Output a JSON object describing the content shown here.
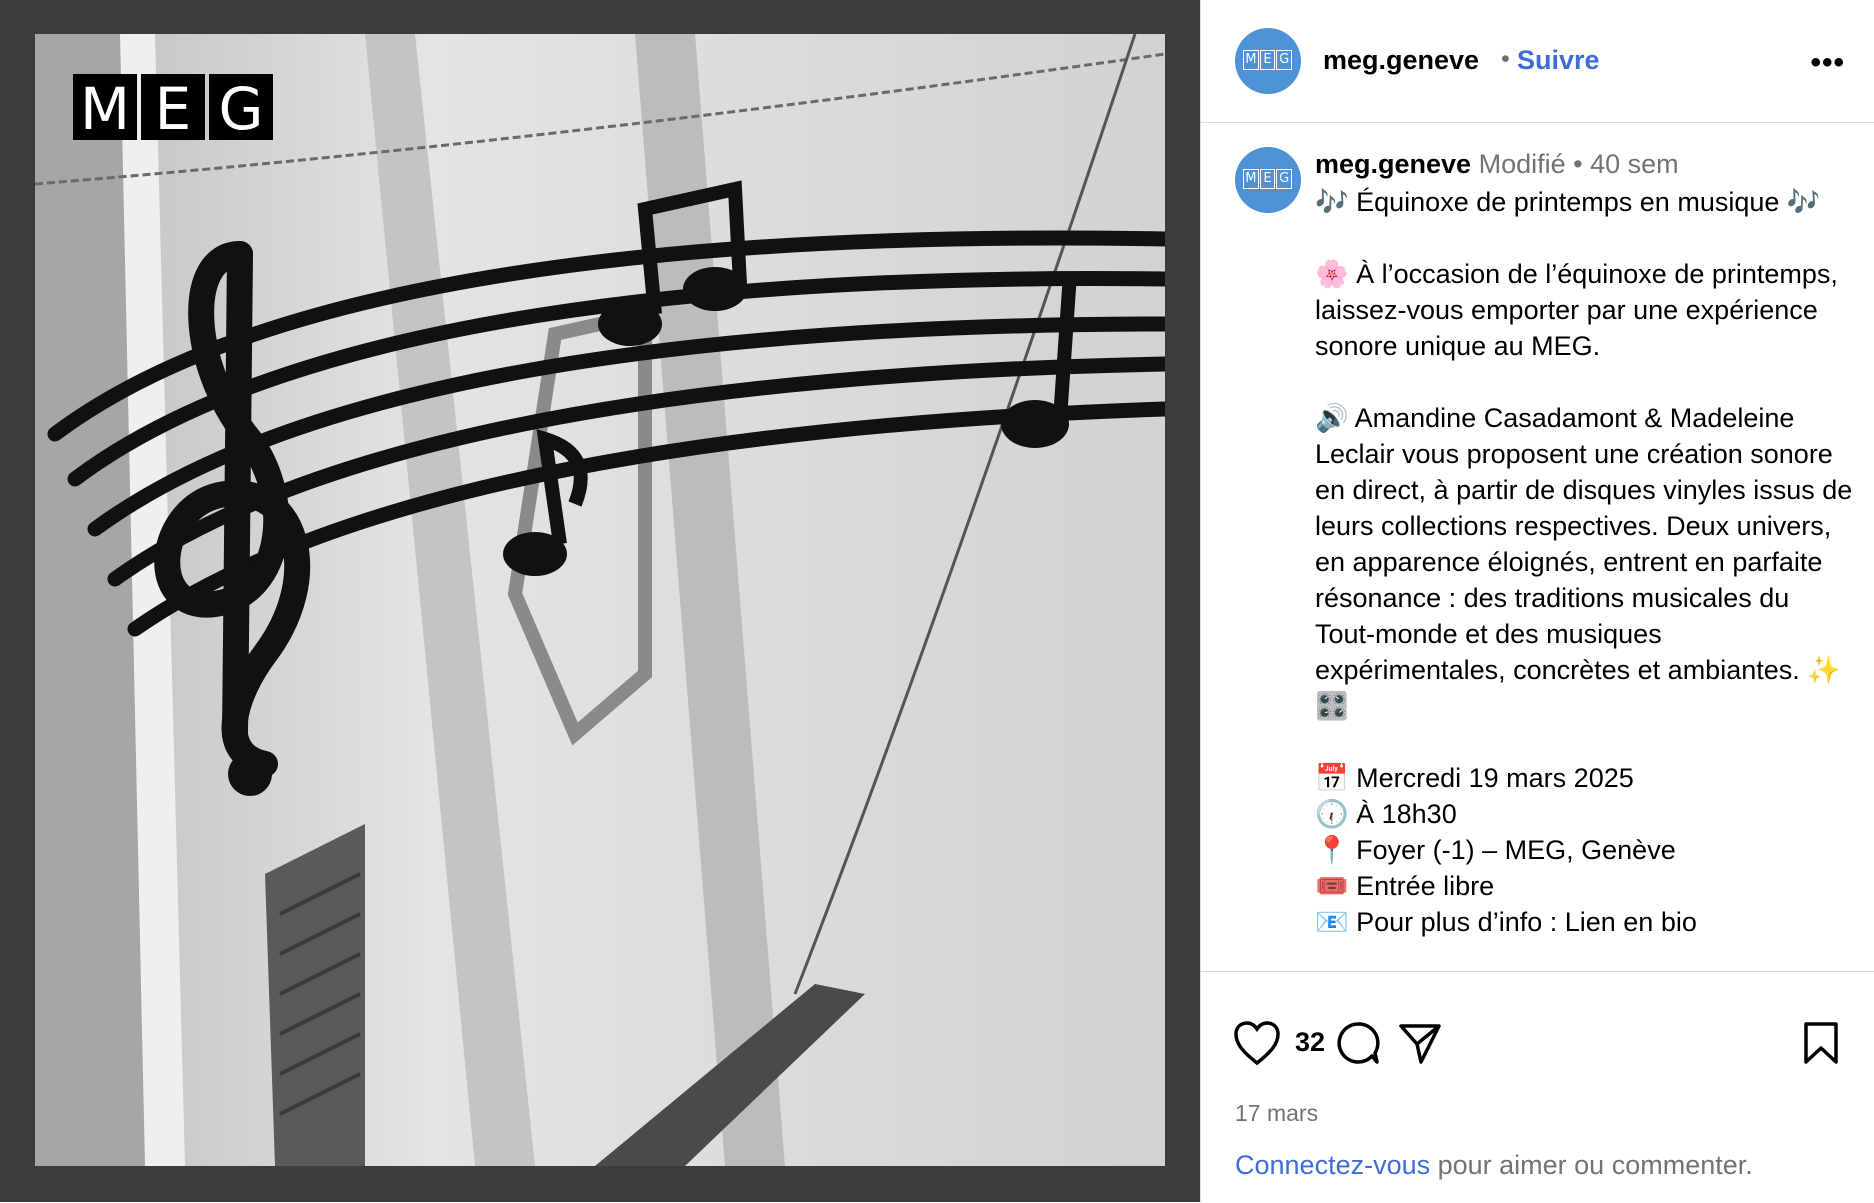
{
  "post": {
    "image": {
      "description": "Black-and-white photo of a building facade with a metal music staff sign, treble clef and notes",
      "logo_text": "MEG"
    },
    "header": {
      "username": "meg.geneve",
      "separator": "•",
      "follow_label": "Suivre",
      "more_icon": "more-options-icon",
      "avatar_logo": "MEG"
    },
    "caption": {
      "username": "meg.geneve",
      "edited": "Modifié",
      "separator": "•",
      "age": "40 sem",
      "paragraphs": [
        [
          "🎶 Équinoxe de printemps en musique 🎶"
        ],
        [
          "🌸 À l’occasion de l’équinoxe de printemps, laissez-vous emporter par une expérience sonore unique au MEG."
        ],
        [
          "🔊 Amandine Casadamont & Madeleine Leclair vous proposent une création sonore en direct, à partir de disques vinyles issus de leurs collections respectives. Deux univers, en apparence éloignés, entrent en parfaite résonance : des traditions musicales du Tout-monde et des musiques expérimentales, concrètes et ambiantes. ✨ 🎛️"
        ],
        [
          "📅 Mercredi 19 mars 2025",
          "🕡 À 18h30",
          "📍 Foyer (-1) – MEG, Genève",
          "🎟️ Entrée libre",
          "📧 Pour plus d’info : Lien en bio"
        ]
      ]
    },
    "actions": {
      "like_icon": "heart-icon",
      "like_count": "32",
      "comment_icon": "comment-icon",
      "share_icon": "share-icon",
      "save_icon": "bookmark-icon"
    },
    "date": "17 mars",
    "login_prompt": {
      "link": "Connectez-vous",
      "text": " pour aimer ou commenter."
    }
  },
  "colors": {
    "accent": "#3f6cd8",
    "muted": "#737373",
    "avatar": "#4d93d6",
    "frame": "#3c3c3c"
  }
}
